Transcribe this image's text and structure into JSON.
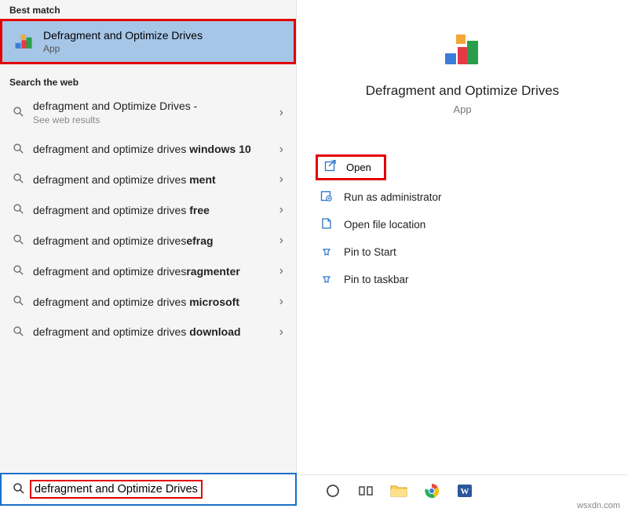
{
  "left": {
    "best_match_label": "Best match",
    "best_match": {
      "title": "Defragment and Optimize Drives",
      "sub": "App"
    },
    "search_web_label": "Search the web",
    "items": [
      {
        "pre": "defragment and Optimize Drives - ",
        "bold": "",
        "sub": "See web results"
      },
      {
        "pre": "defragment and optimize drives ",
        "bold": "windows 10"
      },
      {
        "pre": "defragment and optimize drives ",
        "bold": "ment"
      },
      {
        "pre": "defragment and optimize drives ",
        "bold": "free"
      },
      {
        "pre": "defragment and optimize drives",
        "bold": "efrag"
      },
      {
        "pre": "defragment and optimize drives",
        "bold": "ragmenter"
      },
      {
        "pre": "defragment and optimize drives ",
        "bold": "microsoft"
      },
      {
        "pre": "defragment and optimize drives ",
        "bold": "download"
      }
    ]
  },
  "right": {
    "title": "Defragment and Optimize Drives",
    "sub": "App",
    "actions": {
      "open": "Open",
      "admin": "Run as administrator",
      "loc": "Open file location",
      "pin_start": "Pin to Start",
      "pin_task": "Pin to taskbar"
    }
  },
  "search": {
    "value": "defragment and Optimize Drives"
  },
  "watermark": "wsxdn.com"
}
